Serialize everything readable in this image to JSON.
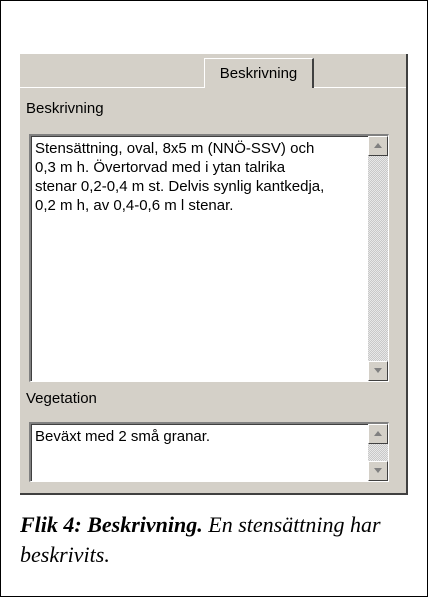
{
  "tab": {
    "label": "Beskrivning"
  },
  "description": {
    "label": "Beskrivning",
    "text": "Stensättning, oval, 8x5 m (NNÖ-SSV) och\n0,3 m h. Övertorvad med i ytan talrika\nstenar 0,2-0,4 m st. Delvis synlig kantkedja,\n0,2 m h, av 0,4-0,6 m l stenar."
  },
  "vegetation": {
    "label": "Vegetation",
    "text": "Beväxt med 2 små granar."
  },
  "caption": {
    "bold": "Flik 4: Beskrivning.",
    "rest": " En stensättning har beskrivits."
  },
  "icons": {
    "scroll_up": "scroll-up-icon",
    "scroll_down": "scroll-down-icon"
  }
}
